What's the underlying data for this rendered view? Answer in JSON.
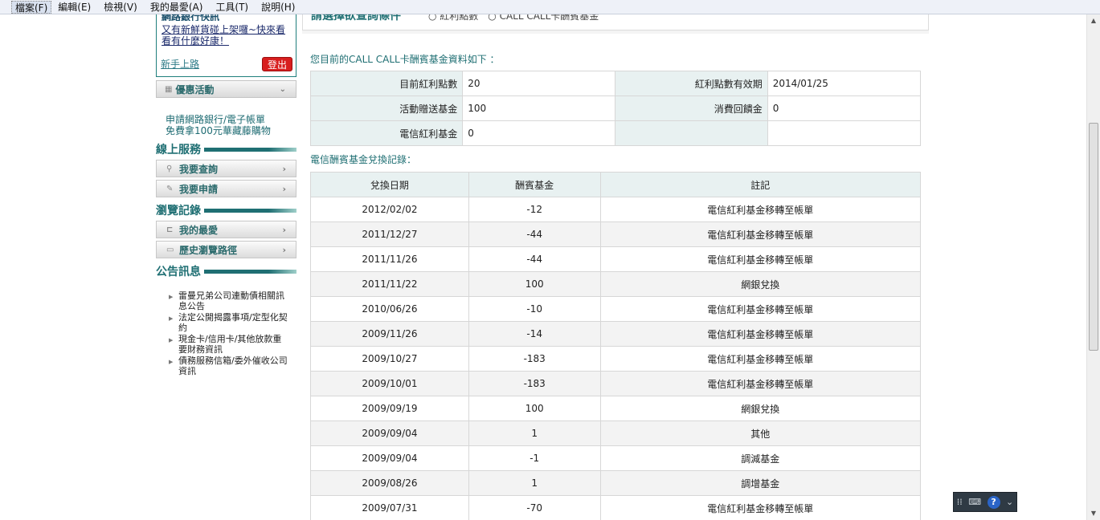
{
  "menu": [
    "檔案(F)",
    "編輯(E)",
    "檢視(V)",
    "我的最愛(A)",
    "工具(T)",
    "說明(H)"
  ],
  "sidebar": {
    "notice_title": "網路銀行快訊",
    "notice_text": "又有新鮮貨碰上架囉~快來看看有什麼好康！",
    "newbie_link": "新手上路",
    "logout": "登出",
    "promo_tab": "優惠活動",
    "apply_link_1": "申請網路銀行/電子帳單",
    "apply_link_2": "免費拿100元華藏藤購物",
    "online_services": {
      "title": "線上服務",
      "items": [
        "我要查詢",
        "我要申請"
      ]
    },
    "browse": {
      "title": "瀏覽記錄",
      "items": [
        "我的最愛",
        "歷史瀏覽路徑"
      ]
    },
    "announcements": {
      "title": "公告訊息",
      "items": [
        "雷曼兄弟公司連動債相關訊息公告",
        "法定公開揭露事項/定型化契約",
        "現金卡/信用卡/其他放款重要財務資訊",
        "債務服務信箱/委外催收公司資訊"
      ]
    }
  },
  "main": {
    "query_title": "請選擇欲查詢條件",
    "query_options": "○ 紅利點數　○ CALL CALL卡酬賓基金",
    "info_heading": "您目前的CALL CALL卡酬賓基金資料如下 ：",
    "info": {
      "points_label": "目前紅利點數",
      "points_value": "20",
      "expiry_label": "紅利點數有效期",
      "expiry_value": "2014/01/25",
      "gift_label": "活動贈送基金",
      "gift_value": "100",
      "rebate_label": "消費回饋金",
      "rebate_value": "0",
      "telecom_label": "電信紅利基金",
      "telecom_value": "0"
    },
    "history_heading": "電信酬賓基金兌換記錄：",
    "history_headers": [
      "兌換日期",
      "酬賓基金",
      "註記"
    ],
    "history_rows": [
      [
        "2012/02/02",
        "-12",
        "電信紅利基金移轉至帳單"
      ],
      [
        "2011/12/27",
        "-44",
        "電信紅利基金移轉至帳單"
      ],
      [
        "2011/11/26",
        "-44",
        "電信紅利基金移轉至帳單"
      ],
      [
        "2011/11/22",
        "100",
        "網銀兌換"
      ],
      [
        "2010/06/26",
        "-10",
        "電信紅利基金移轉至帳單"
      ],
      [
        "2009/11/26",
        "-14",
        "電信紅利基金移轉至帳單"
      ],
      [
        "2009/10/27",
        "-183",
        "電信紅利基金移轉至帳單"
      ],
      [
        "2009/10/01",
        "-183",
        "電信紅利基金移轉至帳單"
      ],
      [
        "2009/09/19",
        "100",
        "網銀兌換"
      ],
      [
        "2009/09/04",
        "1",
        "其他"
      ],
      [
        "2009/09/04",
        "-1",
        "調減基金"
      ],
      [
        "2009/08/26",
        "1",
        "調增基金"
      ],
      [
        "2009/07/31",
        "-70",
        "電信紅利基金移轉至帳單"
      ]
    ]
  },
  "float_toolbar": {
    "help": "?"
  }
}
